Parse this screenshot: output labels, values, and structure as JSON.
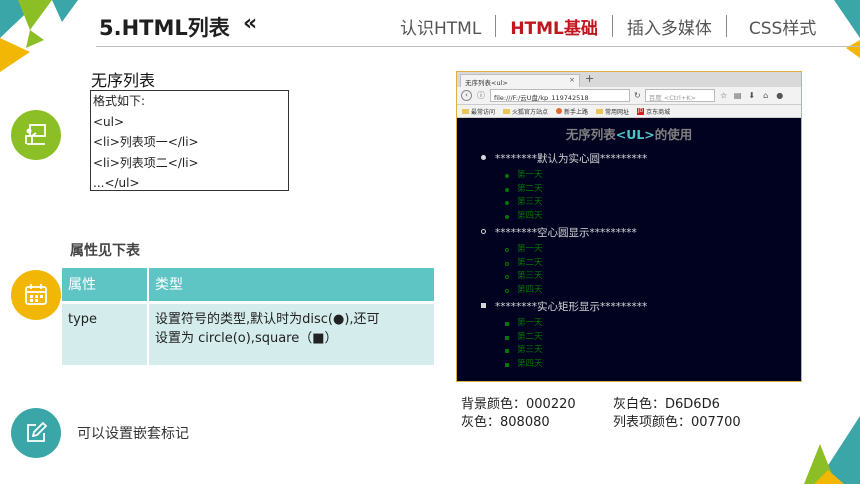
{
  "header": {
    "title": "5.HTML列表",
    "arrow": "«",
    "nav": [
      {
        "label": "认识HTML",
        "active": false
      },
      {
        "label": "HTML基础",
        "active": true
      },
      {
        "label": "插入多媒体",
        "active": false
      },
      {
        "label": "CSS样式",
        "active": false
      }
    ]
  },
  "icons": {
    "presentation": "presentation-board-icon",
    "calendar": "calendar-icon",
    "edit": "edit-pencil-icon"
  },
  "colors": {
    "teal": "#3aa6a8",
    "green": "#8cbf26",
    "yellow": "#f2b705",
    "accent_red": "#c0161e",
    "table_header": "#5fc4c4",
    "table_row": "#d4ecec"
  },
  "unordered": {
    "title": "无序列表",
    "code_lines": [
      "格式如下:",
      "<ul>",
      "<li>列表项一</li>",
      "<li>列表项二</li>",
      "...</ul>"
    ]
  },
  "attributes": {
    "title": "属性见下表",
    "headers": [
      "属性",
      "类型"
    ],
    "rows": [
      {
        "attr": "type",
        "desc_line1": "设置符号的类型,默认时为disc(●),还可",
        "desc_line2": "设置为 circle(o),square（■）"
      }
    ]
  },
  "nested_note": "可以设置嵌套标记",
  "browser": {
    "tab_title": "无序列表<ul>",
    "tab_close": "×",
    "tab_new": "+",
    "url": "file:///F:/云U盘/kp_119742518",
    "search_placeholder": "百度 <Ctrl+K>",
    "bookmarks": [
      "最常访问",
      "火狐官方站点",
      "新手上路",
      "常用网址",
      "京东商城"
    ],
    "page_title_prefix": "无序列表",
    "page_title_tag": "<UL>",
    "page_title_suffix": "的使用",
    "lists": [
      {
        "heading": "********默认为实心圆*********",
        "marker": "disc",
        "items": [
          "第一天",
          "第二天",
          "第三天",
          "第四天"
        ]
      },
      {
        "heading": "********空心圆显示*********",
        "marker": "circle",
        "items": [
          "第一天",
          "第二天",
          "第三天",
          "第四天"
        ]
      },
      {
        "heading": "********实心矩形显示*********",
        "marker": "square",
        "items": [
          "第一天",
          "第二天",
          "第三天",
          "第四天"
        ]
      }
    ]
  },
  "legend": {
    "bg": "背景颜色：000220",
    "gray_white": "灰白色：D6D6D6",
    "gray": "灰色：808080",
    "item_color": "列表项颜色：007700"
  }
}
